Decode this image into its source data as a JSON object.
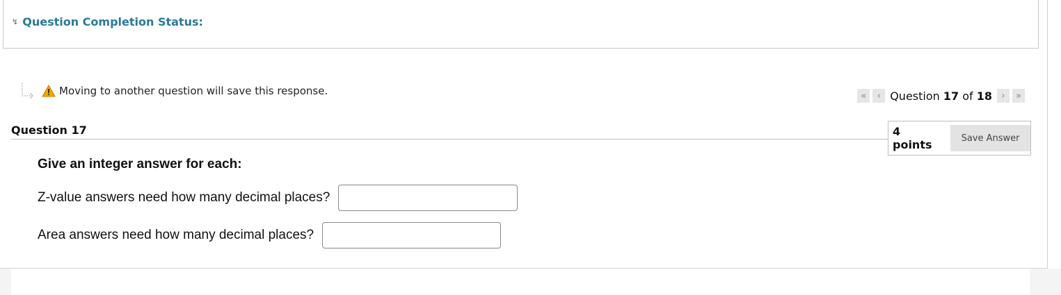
{
  "completion_status": {
    "label": "Question Completion Status:",
    "toggle_icon": "double-chevron-down-icon"
  },
  "notice": {
    "text": "Moving to another question will save this response.",
    "icon": "warning-icon",
    "arrow_icon": "return-arrow-icon"
  },
  "navigator": {
    "prefix": "Question",
    "current": "17",
    "of_label": "of",
    "total": "18",
    "first_icon": "«",
    "prev_icon": "‹",
    "next_icon": "›",
    "last_icon": "»"
  },
  "question": {
    "title": "Question 17",
    "points": "4 points",
    "save_label": "Save Answer",
    "prompt": "Give an integer answer for each:",
    "fields": [
      {
        "label": "Z-value answers need how many decimal places?",
        "value": ""
      },
      {
        "label": "Area answers need how many decimal places?",
        "value": ""
      }
    ]
  },
  "colors": {
    "accent": "#2b7a95",
    "warning": "#f2a900",
    "button_bg": "#e3e3e3"
  }
}
